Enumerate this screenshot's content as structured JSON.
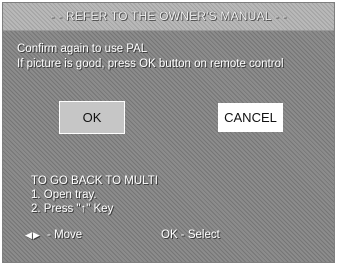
{
  "dialog": {
    "title": "REFER TO THE OWNER'S MANUAL",
    "title_prefix": "- -",
    "title_suffix": "- -",
    "message_line1": "Confirm again to use PAL",
    "message_line2": "If picture is good, press OK button on remote control"
  },
  "buttons": {
    "ok_label": "OK",
    "cancel_label": "CANCEL"
  },
  "instructions": {
    "heading": "TO GO BACK TO MULTI",
    "step1": "1. Open tray.",
    "step2_number": "2.",
    "step2_text": "Press \"↑\" Key"
  },
  "footer": {
    "move_label": "- Move",
    "select_label": "OK - Select",
    "arrow_left": "◀",
    "arrow_right": "▶"
  },
  "colors": {
    "background": "#8c8c8c",
    "title_bar": "#b9b9b9",
    "text": "#ffffff",
    "ok_button": "#c6c6c6",
    "cancel_button": "#ffffff"
  }
}
